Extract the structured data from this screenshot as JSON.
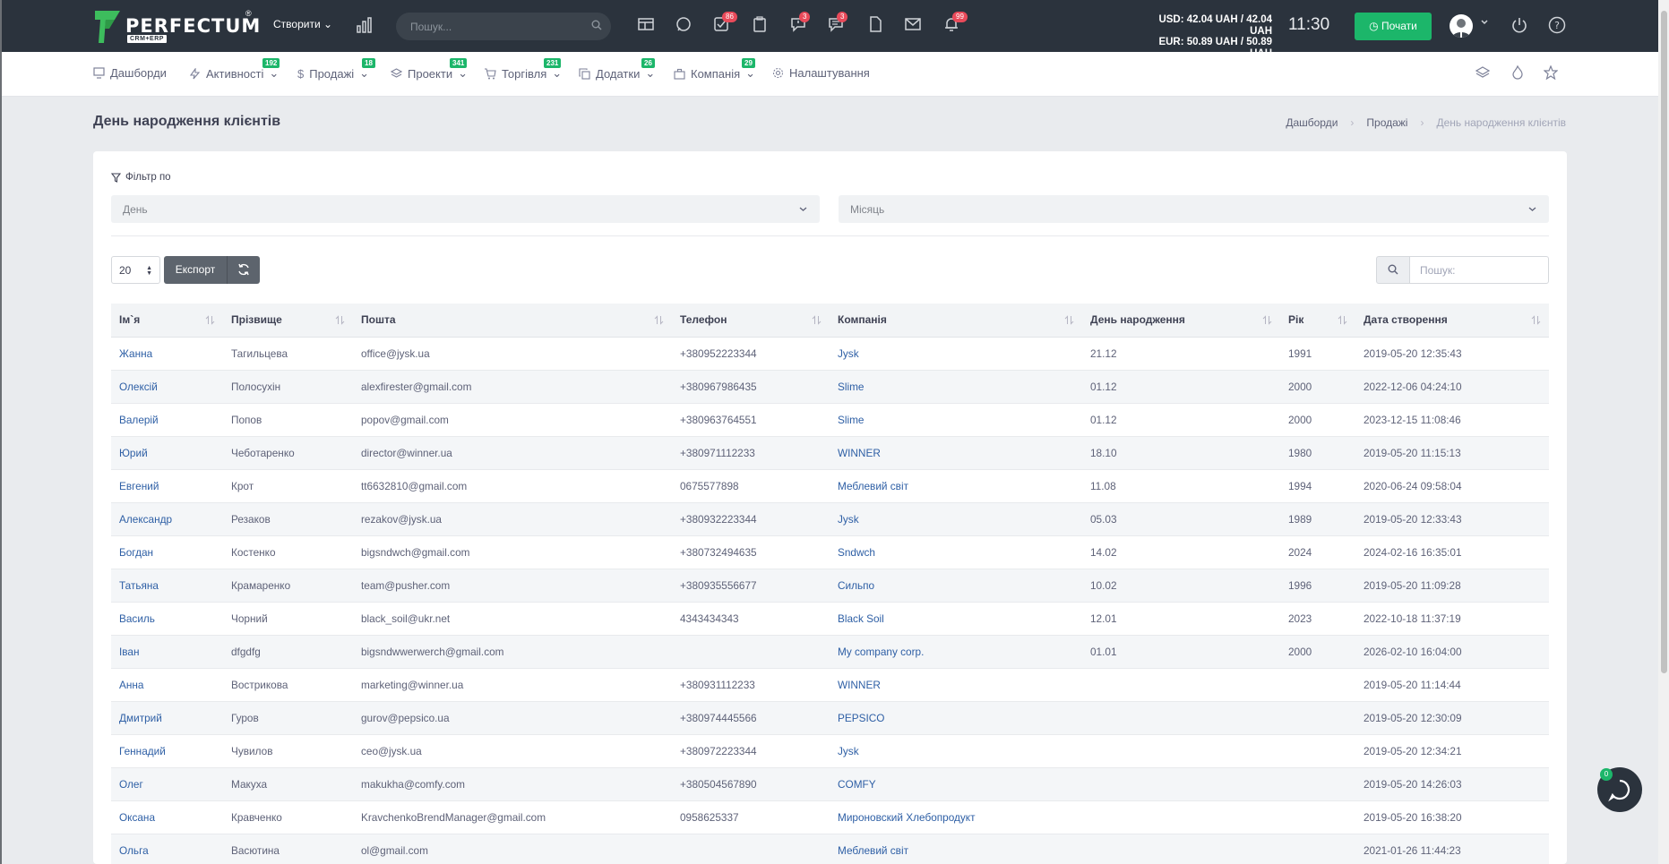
{
  "topbar": {
    "logo_text": "PERFECTUM",
    "logo_sub": "CRM+ERP",
    "create_label": "Створити",
    "search_placeholder": "Пошук...",
    "badges": {
      "tasks": "86",
      "chat": "3",
      "messages": "3",
      "notifications": "99"
    },
    "currency_usd": "USD: 42.04 UAH / 42.04 UAH",
    "currency_eur": "EUR: 50.89 UAH / 50.89 UAH",
    "clock": "11:30",
    "start_label": "Почати"
  },
  "nav": {
    "items": [
      {
        "label": "Дашборди",
        "badge": ""
      },
      {
        "label": "Активності",
        "badge": "192"
      },
      {
        "label": "Продажі",
        "badge": "18"
      },
      {
        "label": "Проекти",
        "badge": "341"
      },
      {
        "label": "Торгівля",
        "badge": "231"
      },
      {
        "label": "Додатки",
        "badge": "26"
      },
      {
        "label": "Компанія",
        "badge": "29"
      },
      {
        "label": "Налаштування",
        "badge": ""
      }
    ]
  },
  "page": {
    "title": "День народження клієнтів",
    "breadcrumb": [
      "Дашборди",
      "Продажі",
      "День народження клієнтів"
    ]
  },
  "filter": {
    "label": "Фільтр по",
    "day_placeholder": "День",
    "month_placeholder": "Місяць"
  },
  "toolbar": {
    "page_size": "20",
    "export_label": "Експорт",
    "search_placeholder": "Пошук:"
  },
  "table": {
    "columns": [
      "Ім`я",
      "Прізвище",
      "Пошта",
      "Телефон",
      "Компанія",
      "День народження",
      "Рік",
      "Дата створення"
    ],
    "rows": [
      [
        "Жанна",
        "Тагильцева",
        "office@jysk.ua",
        "+380952223344",
        "Jysk",
        "21.12",
        "1991",
        "2019-05-20 12:35:43"
      ],
      [
        "Олексій",
        "Полосухін",
        "alexfirester@gmail.com",
        "+380967986435",
        "Slime",
        "01.12",
        "2000",
        "2022-12-06 04:24:10"
      ],
      [
        "Валерій",
        "Попов",
        "popov@gmail.com",
        "+380963764551",
        "Slime",
        "01.12",
        "2000",
        "2023-12-15 11:08:46"
      ],
      [
        "Юрий",
        "Чеботаренко",
        "director@winner.ua",
        "+380971112233",
        "WINNER",
        "18.10",
        "1980",
        "2019-05-20 11:15:13"
      ],
      [
        "Евгений",
        "Крот",
        "tt6632810@gmail.com",
        "0675577898",
        "Меблевий світ",
        "11.08",
        "1994",
        "2020-06-24 09:58:04"
      ],
      [
        "Александр",
        "Резаков",
        "rezakov@jysk.ua",
        "+380932223344",
        "Jysk",
        "05.03",
        "1989",
        "2019-05-20 12:33:43"
      ],
      [
        "Богдан",
        "Костенко",
        "bigsndwch@gmail.com",
        "+380732494635",
        "Sndwch",
        "14.02",
        "2024",
        "2024-02-16 16:35:01"
      ],
      [
        "Татьяна",
        "Крамаренко",
        "team@pusher.com",
        "+380935556677",
        "Сильпо",
        "10.02",
        "1996",
        "2019-05-20 11:09:28"
      ],
      [
        "Василь",
        "Чорний",
        "black_soil@ukr.net",
        "4343434343",
        "Black Soil",
        "12.01",
        "2023",
        "2022-10-18 11:37:19"
      ],
      [
        "Іван",
        "dfgdfg",
        "bigsndwwerwerch@gmail.com",
        "",
        "My company corp.",
        "01.01",
        "2000",
        "2026-02-10 16:04:00"
      ],
      [
        "Анна",
        "Вострикова",
        "marketing@winner.ua",
        "+380931112233",
        "WINNER",
        "",
        "",
        "2019-05-20 11:14:44"
      ],
      [
        "Дмитрий",
        "Гуров",
        "gurov@pepsico.ua",
        "+380974445566",
        "PEPSICO",
        "",
        "",
        "2019-05-20 12:30:09"
      ],
      [
        "Геннадий",
        "Чувилов",
        "ceo@jysk.ua",
        "+380972223344",
        "Jysk",
        "",
        "",
        "2019-05-20 12:34:21"
      ],
      [
        "Олег",
        "Макуха",
        "makukha@comfy.com",
        "+380504567890",
        "COMFY",
        "",
        "",
        "2019-05-20 14:26:03"
      ],
      [
        "Оксана",
        "Кравченко",
        "KravchenkoBrendManager@gmail.com",
        "0958625337",
        "Мироновский Хлебопродукт",
        "",
        "",
        "2019-05-20 16:38:20"
      ],
      [
        "Ольга",
        "Васютина",
        "ol@gmail.com",
        "",
        "Меблевий світ",
        "",
        "",
        "2021-01-26 11:44:23"
      ]
    ]
  },
  "chat": {
    "badge": "0"
  },
  "colors": {
    "topbar": "#2b333d",
    "accent_green": "#1cb66a",
    "badge_red": "#e94a5a",
    "link": "#2e5fa5"
  },
  "icons": [
    "logo-icon",
    "chart-icon",
    "search-icon",
    "newspaper-icon",
    "check-square-icon",
    "comment-icon",
    "clipboard-icon",
    "chat-alert-icon",
    "messages-icon",
    "file-icon",
    "mail-icon",
    "bell-icon",
    "clock-icon",
    "power-icon",
    "help-icon",
    "layers-icon",
    "fire-icon",
    "star-icon",
    "filter-icon",
    "refresh-icon",
    "sort-icon"
  ]
}
